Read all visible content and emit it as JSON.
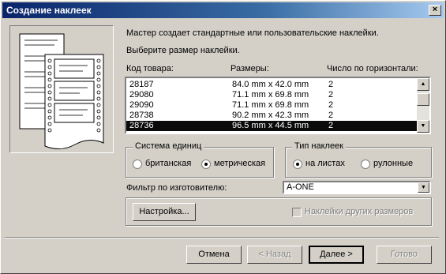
{
  "window": {
    "title": "Создание наклеек",
    "close_glyph": "×"
  },
  "intro": {
    "line1": "Мастер создает стандартные или пользовательские наклейки.",
    "line2": "Выберите размер наклейки."
  },
  "table": {
    "headers": [
      "Код товара:",
      "Размеры:",
      "Число по горизонтали:"
    ],
    "rows": [
      {
        "code": "28187",
        "size": "84.0 mm x 42.0 mm",
        "count": "2"
      },
      {
        "code": "29080",
        "size": "71.1 mm x 69.8 mm",
        "count": "2"
      },
      {
        "code": "29090",
        "size": "71.1 mm x 69.8 mm",
        "count": "2"
      },
      {
        "code": "28738",
        "size": "90.2 mm x 42.3 mm",
        "count": "2"
      },
      {
        "code": "28736",
        "size": "96.5 mm x 44.5 mm",
        "count": "2"
      }
    ],
    "selected_index": 4
  },
  "units": {
    "label": "Система единиц",
    "options": [
      "британская",
      "метрическая"
    ],
    "selected": "метрическая"
  },
  "label_type": {
    "label": "Тип наклеек",
    "options": [
      "на листах",
      "рулонные"
    ],
    "selected": "на листах"
  },
  "filter": {
    "label": "Фильтр по изготовителю:",
    "value": "A-ONE"
  },
  "buttons": {
    "customize": "Настройка...",
    "cancel": "Отмена",
    "back": "< Назад",
    "next": "Далее >",
    "finish": "Готово"
  },
  "other_sizes": {
    "label": "Наклейки других размеров",
    "checked": false,
    "enabled": false
  }
}
